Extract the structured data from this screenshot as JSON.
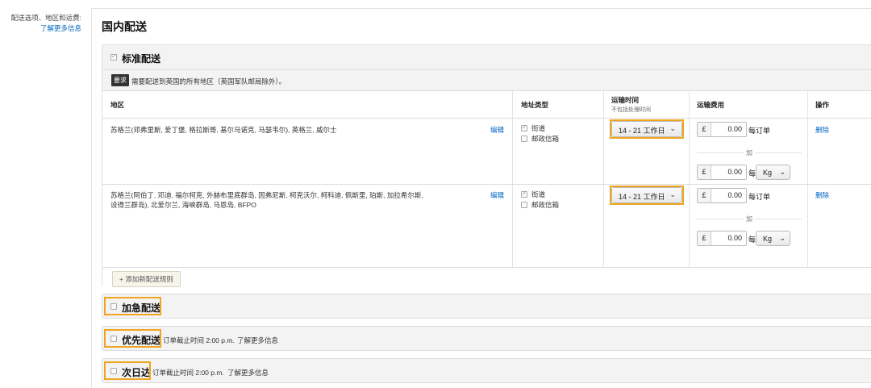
{
  "left_nav": {
    "line1": "配送选项、地区和运费:",
    "link": "了解更多信息"
  },
  "page_title": "国内配送",
  "standard": {
    "title": "标准配送",
    "requirement_badge": "要求",
    "requirement_text": "需要配送到英国的所有地区（英国军队邮局除外）。",
    "headers": {
      "region": "地区",
      "address_type": "地址类型",
      "transit": "运输时间",
      "transit_sub": "不包括处理时间",
      "fee": "运输费用",
      "action": "操作"
    },
    "rows": [
      {
        "region": "苏格兰(邓弗里斯, 爱丁堡, 格拉斯哥, 基尔马诺克, 马瑟韦尔), 英格兰, 威尔士",
        "edit": "编辑",
        "addr1": "街道",
        "addr1_checked": true,
        "addr2": "邮政信箱",
        "addr2_checked": false,
        "transit": "14 - 21 工作日",
        "currency": "£",
        "per_order_value": "0.00",
        "per_order_label": "每订单",
        "plus": "加",
        "per_unit_value": "0.00",
        "per_unit_label": "每",
        "unit": "Kg",
        "delete": "删除"
      },
      {
        "region": "苏格兰(阿伯丁, 邓迪, 福尔柯克, 外赫布里底群岛, 因弗尼斯, 柯克沃尔, 柯科迪, 佩斯里, 珀斯, 加拉希尔斯, 设得兰群岛), 北爱尔兰, 海峡群岛, 马恩岛, BFPO",
        "edit": "编辑",
        "addr1": "街道",
        "addr1_checked": true,
        "addr2": "邮政信箱",
        "addr2_checked": false,
        "transit": "14 - 21 工作日",
        "currency": "£",
        "per_order_value": "0.00",
        "per_order_label": "每订单",
        "plus": "加",
        "per_unit_value": "0.00",
        "per_unit_label": "每",
        "unit": "Kg",
        "delete": "删除"
      }
    ],
    "add_rule": "+ 添加新配送规则"
  },
  "expedited": {
    "title": "加急配送"
  },
  "priority": {
    "title": "优先配送",
    "cutoff": "订单截止时间 2:00 p.m.",
    "link": "了解更多信息"
  },
  "next_day": {
    "title": "次日达",
    "cutoff": "订单截止时间 2:00 p.m.",
    "link": "了解更多信息"
  },
  "highlight_color": "#f0a521",
  "link_color": "#0066c0"
}
